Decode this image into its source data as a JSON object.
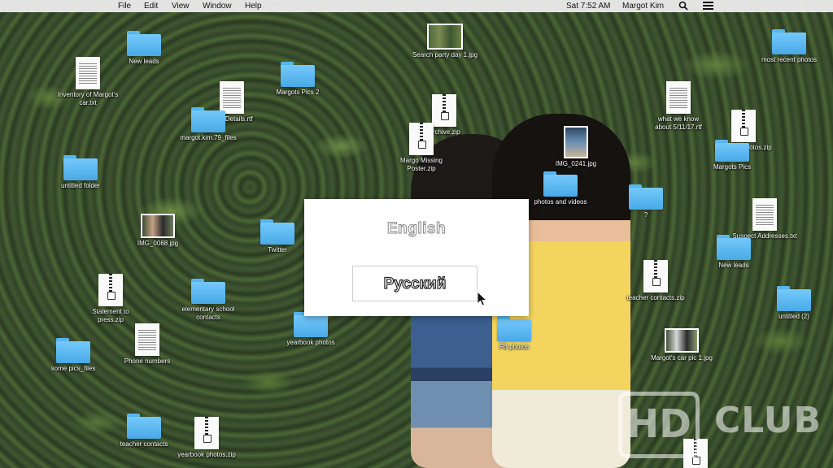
{
  "menubar": {
    "menus": [
      "File",
      "Edit",
      "View",
      "Window",
      "Help"
    ],
    "clock": "Sat 7:52 AM",
    "user": "Margot Kim",
    "icons": [
      "search-icon",
      "list-menu-icon"
    ]
  },
  "desktop": {
    "items": [
      {
        "label": "New leads",
        "type": "folder"
      },
      {
        "label": "Inventory of Margot's car.txt",
        "type": "doc"
      },
      {
        "label": "Odd Details.rtf",
        "type": "doc"
      },
      {
        "label": "Margots Pics 2",
        "type": "folder"
      },
      {
        "label": "margot.kim.79_files",
        "type": "folder"
      },
      {
        "label": "Search party day 1.jpg",
        "type": "image"
      },
      {
        "label": "Archive.zip",
        "type": "zip"
      },
      {
        "label": "Margo Missing Poster.zip",
        "type": "zip"
      },
      {
        "label": "IMG_0241.jpg",
        "type": "image"
      },
      {
        "label": "untitled folder",
        "type": "folder"
      },
      {
        "label": "IMG_0068.jpg",
        "type": "image"
      },
      {
        "label": "Twitter",
        "type": "folder"
      },
      {
        "label": "photos and videos",
        "type": "folder"
      },
      {
        "label": "?",
        "type": "folder"
      },
      {
        "label": "most recent photos",
        "type": "folder"
      },
      {
        "label": "what we know about 5/11/17.rtf",
        "type": "doc"
      },
      {
        "label": "personal photos.zip",
        "type": "zip"
      },
      {
        "label": "Margots Pics",
        "type": "folder"
      },
      {
        "label": "Suspect Addresses.txt",
        "type": "doc"
      },
      {
        "label": "New leads",
        "type": "folder"
      },
      {
        "label": "Statement to press.zip",
        "type": "zip"
      },
      {
        "label": "elementary school contacts",
        "type": "folder"
      },
      {
        "label": "yearbook photos",
        "type": "folder"
      },
      {
        "label": "FB photos",
        "type": "folder"
      },
      {
        "label": "teacher contacts.zip",
        "type": "zip"
      },
      {
        "label": "untitled (2)",
        "type": "folder"
      },
      {
        "label": "some pics_files",
        "type": "folder"
      },
      {
        "label": "Phone numbers",
        "type": "doc"
      },
      {
        "label": "Margot's car pic 1.jpg",
        "type": "image"
      },
      {
        "label": "teacher contacts",
        "type": "folder"
      },
      {
        "label": "yearbook photos.zip",
        "type": "zip"
      }
    ]
  },
  "language_dialog": {
    "option_english": "English",
    "option_russian": "Русский"
  },
  "watermark": {
    "logo": "HD",
    "text": "CLUB"
  },
  "colors": {
    "folder": "#5ab8f2",
    "menubar": "#ececec"
  }
}
